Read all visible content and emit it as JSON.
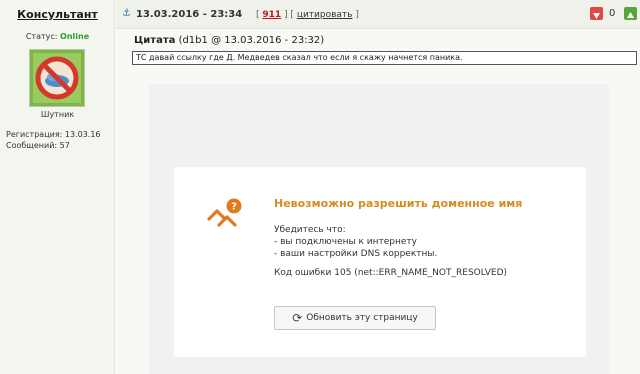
{
  "user": {
    "name": "Консультант",
    "status_label": "Статус:",
    "status_value": "Online",
    "avatar_caption": "Шутник",
    "registration": "Регистрация: 13.03.16",
    "messages": "Сообщений: 57"
  },
  "header": {
    "date": "13.03.2016 - 23:34",
    "bracket_open": "[",
    "post_number": "911",
    "separator": "] [",
    "quote_label": "цитировать",
    "bracket_close": "]",
    "rating": "0"
  },
  "quote": {
    "label": "Цитата",
    "meta": "(d1b1 @ 13.03.2016 - 23:32)",
    "text": "ТС давай ссылку где Д. Медведев сказал что если я скажу начнется паника."
  },
  "error_page": {
    "title": "Невозможно разрешить доменное имя",
    "check_intro": "Убедитесь что:",
    "check_1": "- вы подключены к интернету",
    "check_2": "- ваши настройки DNS корректны.",
    "code": "Код ошибки 105 (net::ERR_NAME_NOT_RESOLVED)",
    "reload_label": "Обновить эту страницу"
  },
  "colors": {
    "online": "#2e9b2e",
    "post_number": "#c0141b",
    "error_title": "#d58c1e",
    "icon_orange": "#e07a1f"
  }
}
